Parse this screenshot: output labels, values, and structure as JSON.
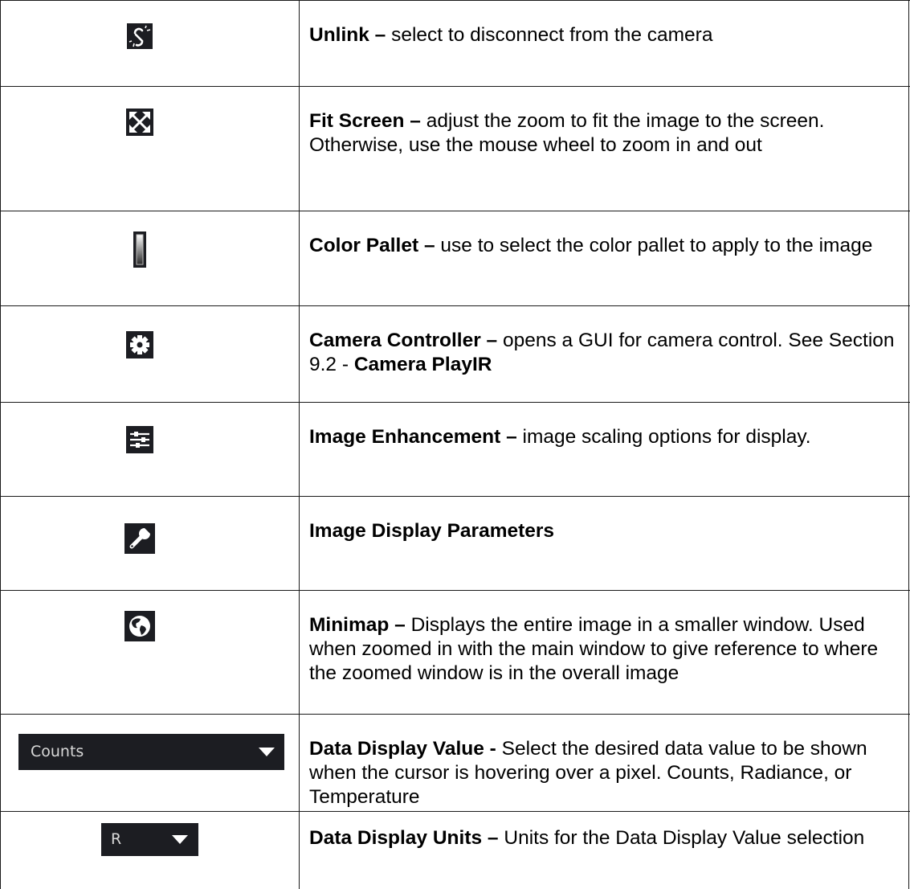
{
  "rows": [
    {
      "icon": "unlink-icon",
      "term": "Unlink –",
      "desc": " select to disconnect from the camera"
    },
    {
      "icon": "fit-screen-icon",
      "term": "Fit Screen –",
      "desc": " adjust the zoom to fit the image to the screen.  Otherwise, use the mouse wheel to zoom in and out"
    },
    {
      "icon": "color-pallet-icon",
      "term": "Color Pallet –",
      "desc": " use to select the color pallet to apply to the image"
    },
    {
      "icon": "gear-icon",
      "term": "Camera Controller –",
      "desc": " opens a GUI for camera control.  See Section 9.2 - ",
      "desc_bold": "Camera PlayIR"
    },
    {
      "icon": "sliders-icon",
      "term": "Image Enhancement –",
      "desc": " image scaling options for display."
    },
    {
      "icon": "wrench-icon",
      "term": "Image Display Parameters",
      "desc": ""
    },
    {
      "icon": "globe-icon",
      "term": "Minimap –",
      "desc": " Displays the entire image in a smaller window.  Used when zoomed in with the main window to give reference to where the zoomed window is in the overall image"
    },
    {
      "icon": "data-value-dropdown",
      "dropdown_value": "Counts",
      "term": "Data Display Value -",
      "desc": " Select the desired data value to be shown when the cursor is hovering over a pixel.  Counts, Radiance, or Temperature"
    },
    {
      "icon": "data-units-dropdown",
      "dropdown_value": "R",
      "term": "Data Display Units –",
      "desc": " Units for the Data Display Value selection"
    }
  ]
}
